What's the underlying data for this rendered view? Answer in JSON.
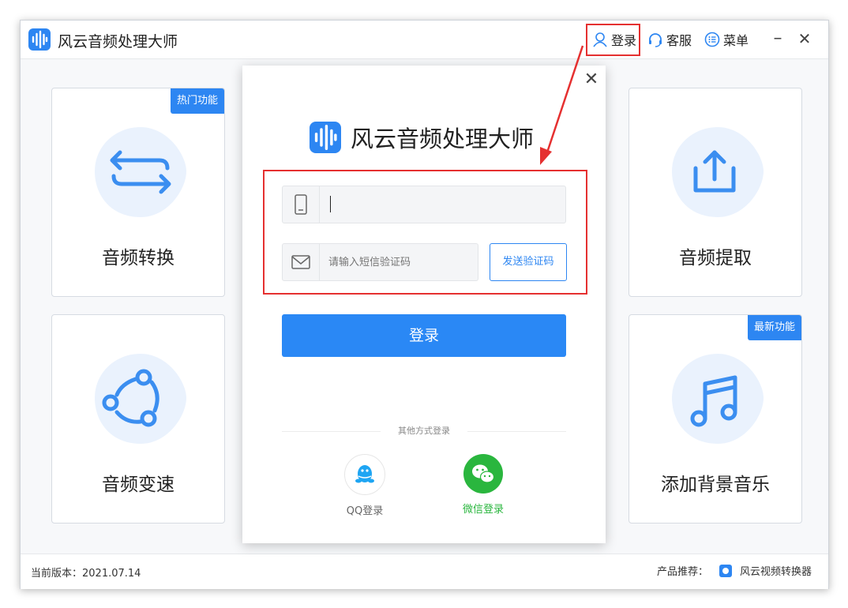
{
  "app": {
    "title": "风云音频处理大师"
  },
  "titlebar": {
    "login": "登录",
    "service": "客服",
    "menu": "菜单",
    "minimize": "–",
    "close": "✕"
  },
  "cards": [
    {
      "label": "音频转换",
      "badge": "热门功能",
      "icon": "convert-arrows-icon"
    },
    {
      "label": "音频提取",
      "badge": "",
      "icon": "upload-tray-icon"
    },
    {
      "label": "音频变速",
      "badge": "",
      "icon": "speed-cycle-icon"
    },
    {
      "label": "添加背景音乐",
      "badge": "最新功能",
      "icon": "music-note-icon"
    }
  ],
  "dialog": {
    "title": "风云音频处理大师",
    "close": "✕",
    "phone_placeholder": "",
    "code_placeholder": "请输入短信验证码",
    "send_code": "发送验证码",
    "login_button": "登录",
    "other_methods": "其他方式登录",
    "qq_login": "QQ登录",
    "wechat_login": "微信登录"
  },
  "footer": {
    "version": "当前版本：2021.07.14",
    "recommend_label": "产品推荐：",
    "recommend_product": "风云视频转换器"
  },
  "colors": {
    "accent": "#2d86f2",
    "highlight_red": "#e53030",
    "wechat_green": "#2ab63e",
    "qq_blue": "#1ea5f3",
    "card_blob": "#eaf2fd"
  }
}
